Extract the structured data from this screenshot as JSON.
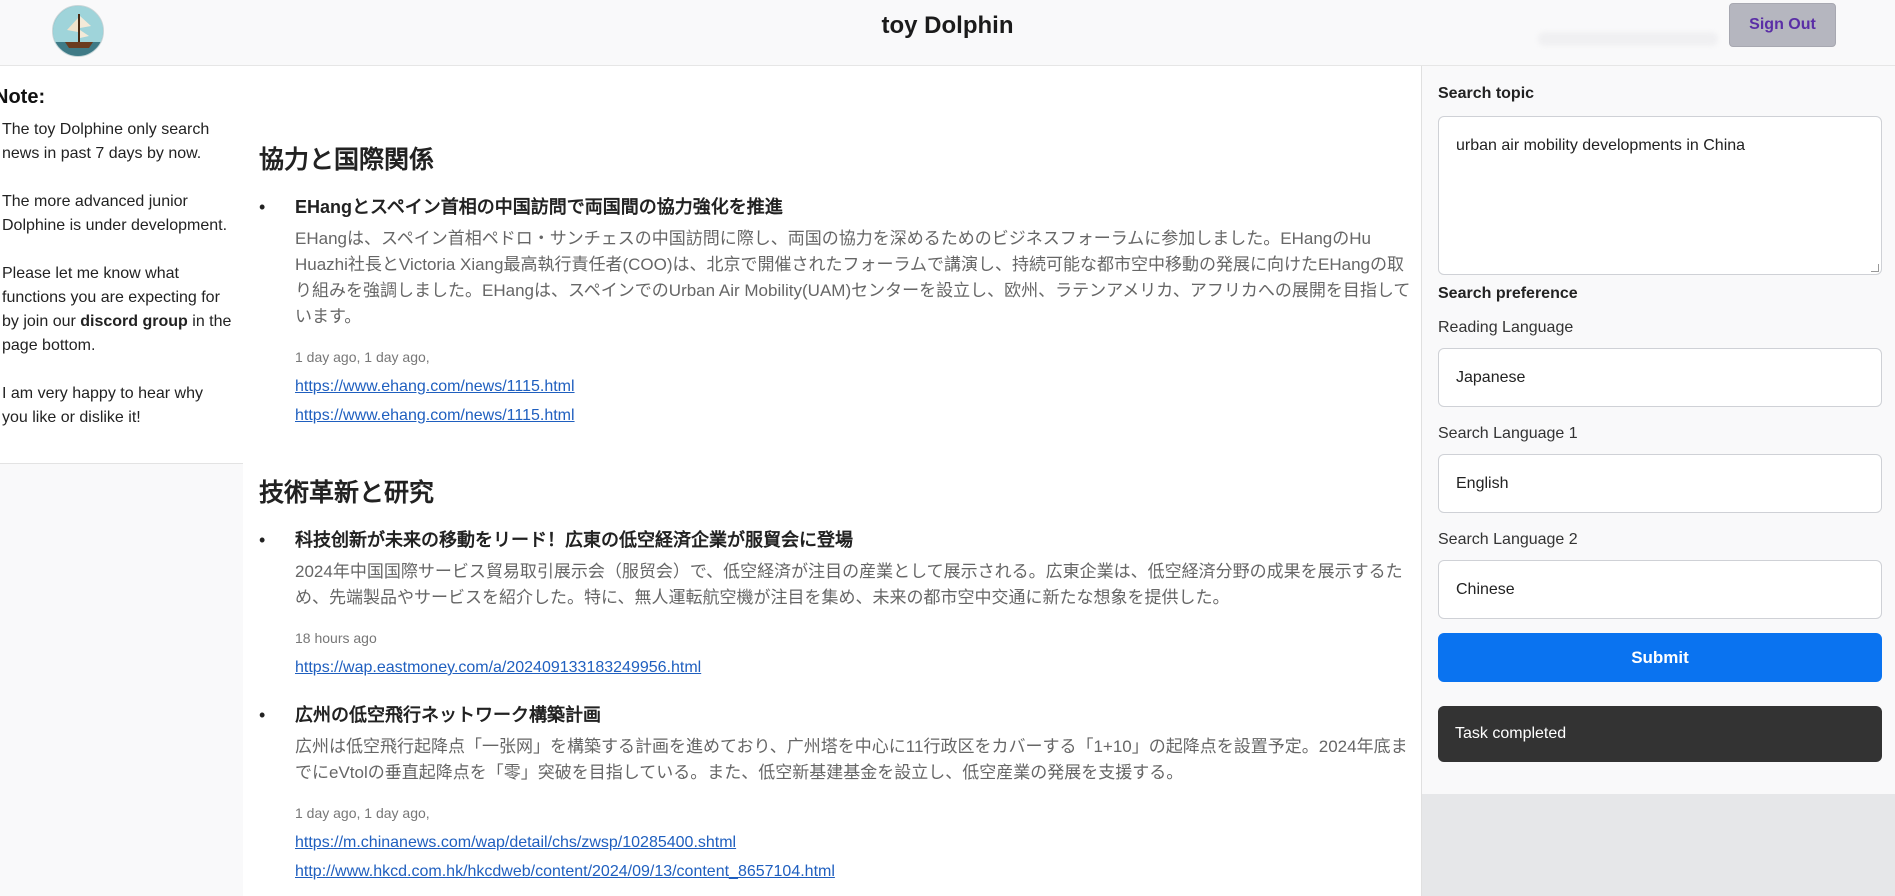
{
  "header": {
    "title": "toy Dolphin",
    "sign_out_label": "Sign Out"
  },
  "note": {
    "title": "Note:",
    "p1": "The toy Dolphine only search news in past 7 days by now.",
    "p2": "The more advanced junior Dolphine is under development.",
    "p3_before": "Please let me know what functions you are expecting for by join our ",
    "p3_bold": "discord group",
    "p3_after": " in the page bottom.",
    "p4": "I am very happy to hear why you like or dislike it!"
  },
  "sections": [
    {
      "title": "協力と国際関係",
      "articles": [
        {
          "title": "EHangとスペイン首相の中国訪問で両国間の協力強化を推進",
          "body": "EHangは、スペイン首相ペドロ・サンチェスの中国訪問に際し、両国の協力を深めるためのビジネスフォーラムに参加しました。EHangのHu Huazhi社長とVictoria Xiang最高執行責任者(COO)は、北京で開催されたフォーラムで講演し、持続可能な都市空中移動の発展に向けたEHangの取り組みを強調しました。EHangは、スペインでのUrban Air Mobility(UAM)センターを設立し、欧州、ラテンアメリカ、アフリカへの展開を目指しています。",
          "time": "1 day ago, 1 day ago,",
          "links": [
            "https://www.ehang.com/news/1115.html",
            "https://www.ehang.com/news/1115.html"
          ]
        }
      ]
    },
    {
      "title": "技術革新と研究",
      "articles": [
        {
          "title": "科技创新が未来の移動をリード！広東の低空経済企業が服貿会に登場",
          "body": "2024年中国国際サービス貿易取引展示会（服贸会）で、低空経済が注目の産業として展示される。広東企業は、低空経済分野の成果を展示するため、先端製品やサービスを紹介した。特に、無人運転航空機が注目を集め、未来の都市空中交通に新たな想象を提供した。",
          "time": "18 hours ago",
          "links": [
            "https://wap.eastmoney.com/a/202409133183249956.html"
          ]
        },
        {
          "title": "広州の低空飛行ネットワーク構築計画",
          "body": "広州は低空飛行起降点「一张网」を構築する計画を進めており、广州塔を中心に11行政区をカバーする「1+10」の起降点を設置予定。2024年底までにeVtolの垂直起降点を「零」突破を目指している。また、低空新基建基金を設立し、低空産業の発展を支援する。",
          "time": "1 day ago, 1 day ago,",
          "links": [
            "https://m.chinanews.com/wap/detail/chs/zwsp/10285400.shtml",
            "http://www.hkcd.com.hk/hkcdweb/content/2024/09/13/content_8657104.html"
          ]
        }
      ]
    }
  ],
  "form": {
    "topic_label": "Search topic",
    "topic_value": "urban air mobility developments in China",
    "preference_label": "Search preference",
    "reading_language_label": "Reading Language",
    "reading_language_value": "Japanese",
    "search_language_1_label": "Search Language 1",
    "search_language_1_value": "English",
    "search_language_2_label": "Search Language 2",
    "search_language_2_value": "Chinese",
    "submit_label": "Submit",
    "status_text": "Task completed"
  }
}
